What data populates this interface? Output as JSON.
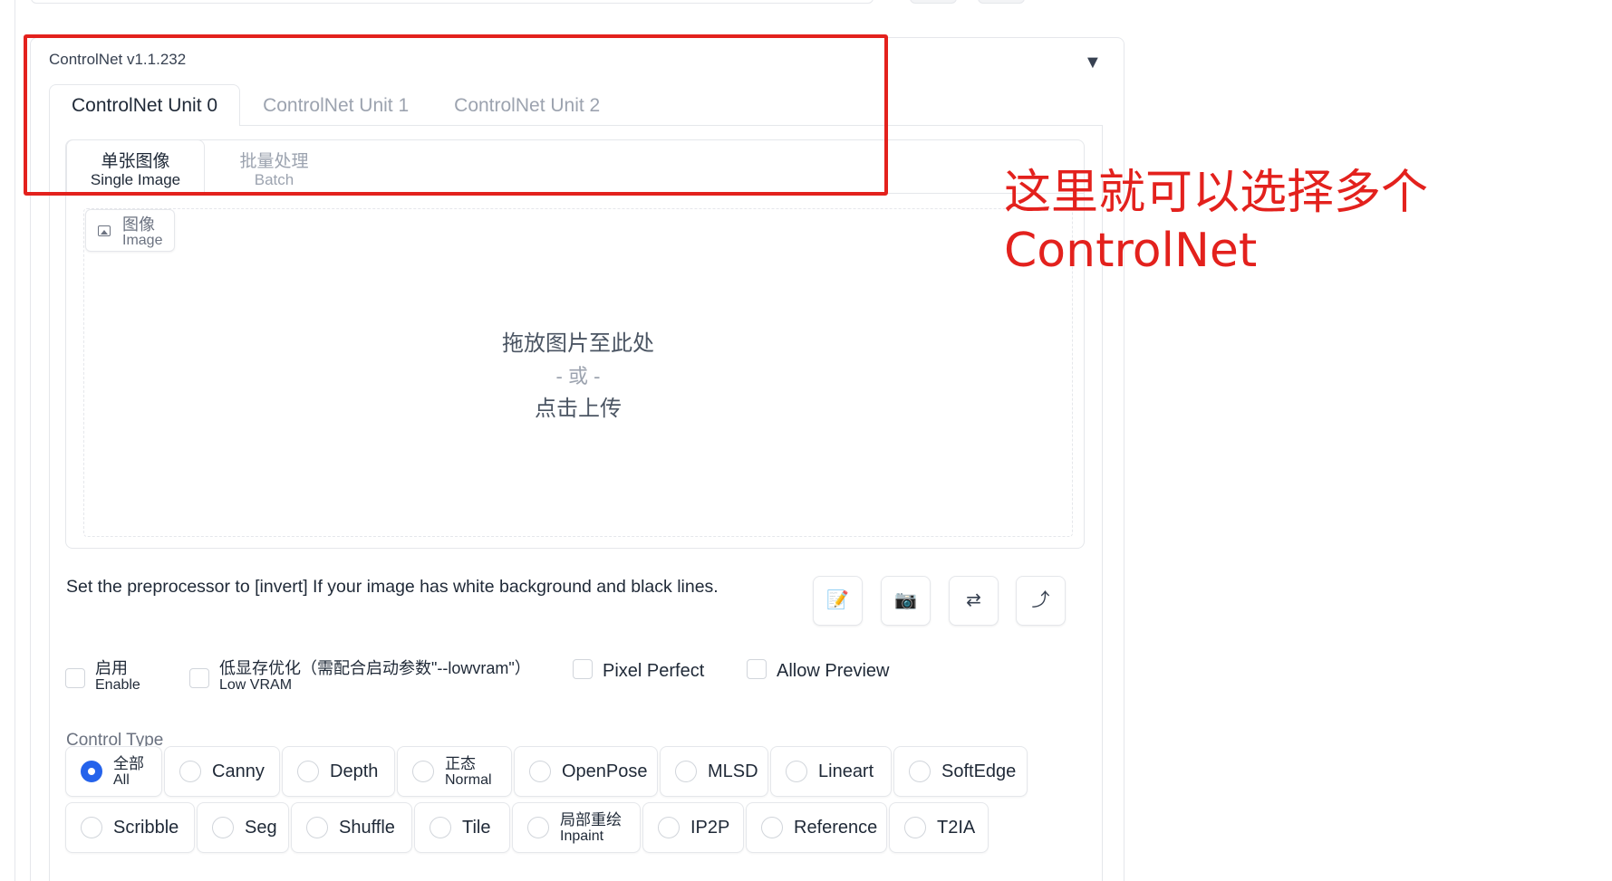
{
  "panel": {
    "title": "ControlNet v1.1.232",
    "collapse_icon": "triangle-down-icon",
    "collapse_glyph": "▼"
  },
  "unit_tabs": [
    "ControlNet Unit 0",
    "ControlNet Unit 1",
    "ControlNet Unit 2"
  ],
  "image_tabs": [
    {
      "zh": "单张图像",
      "en": "Single Image"
    },
    {
      "zh": "批量处理",
      "en": "Batch"
    }
  ],
  "upload": {
    "label_zh": "图像",
    "label_en": "Image",
    "icon": "image-icon",
    "drop_text": "拖放图片至此处",
    "or_text": "- 或 -",
    "click_text": "点击上传"
  },
  "hint": "Set the preprocessor to [invert] If your image has white background and black lines.",
  "tool_buttons": [
    {
      "icon": "edit-icon",
      "glyph": "📝"
    },
    {
      "icon": "camera-icon",
      "glyph": "📷"
    },
    {
      "icon": "swap-icon",
      "glyph": "⇄"
    },
    {
      "icon": "send-dimensions-icon",
      "glyph": "⤴"
    }
  ],
  "checkboxes": [
    {
      "zh": "启用",
      "en": "Enable",
      "checked": false
    },
    {
      "zh": "低显存优化（需配合启动参数\"--lowvram\"）",
      "en": "Low VRAM",
      "checked": false
    },
    {
      "label": "Pixel Perfect",
      "checked": false
    },
    {
      "label": "Allow Preview",
      "checked": false
    }
  ],
  "control_type": {
    "label": "Control Type",
    "selected": "全部",
    "options": [
      {
        "zh": "全部",
        "en": "All"
      },
      {
        "label": "Canny"
      },
      {
        "label": "Depth"
      },
      {
        "zh": "正态",
        "en": "Normal"
      },
      {
        "label": "OpenPose"
      },
      {
        "label": "MLSD"
      },
      {
        "label": "Lineart"
      },
      {
        "label": "SoftEdge"
      },
      {
        "label": "Scribble"
      },
      {
        "label": "Seg"
      },
      {
        "label": "Shuffle"
      },
      {
        "label": "Tile"
      },
      {
        "zh": "局部重绘",
        "en": "Inpaint"
      },
      {
        "label": "IP2P"
      },
      {
        "label": "Reference"
      },
      {
        "label": "T2IA"
      }
    ]
  },
  "annotation": {
    "line1": "这里就可以选择多个",
    "line2": "ControlNet",
    "color": "#e3211d"
  }
}
